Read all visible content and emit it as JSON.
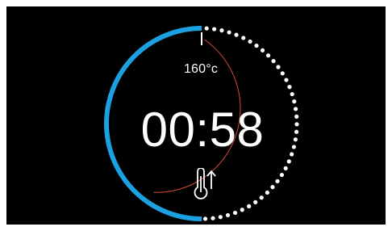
{
  "oven_display": {
    "temperature": "160°c",
    "timer": "00:58",
    "progress": 0.5,
    "icon": "thermometer-rising-icon",
    "colors": {
      "background": "#000000",
      "progress_arc": "#1ba0e2",
      "remaining_dots": "#ffffff",
      "inner_arc": "#d94a3a",
      "text": "#ffffff"
    }
  }
}
